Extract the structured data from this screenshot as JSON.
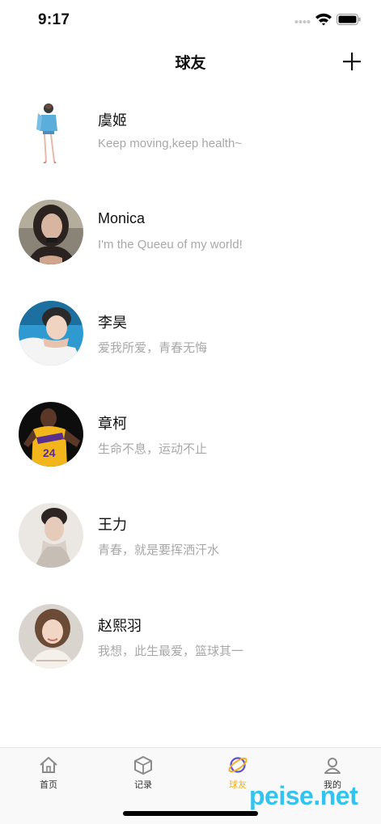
{
  "status_bar": {
    "time": "9:17"
  },
  "nav": {
    "title": "球友",
    "add_icon": "plus-icon"
  },
  "friends": [
    {
      "name": "虞姬",
      "motto": "Keep moving,keep health~",
      "avatar": "illustration"
    },
    {
      "name": "Monica",
      "motto": "I'm the Queeu of my world!",
      "avatar": "photo"
    },
    {
      "name": "李昊",
      "motto": "爱我所爱，青春无悔",
      "avatar": "photo"
    },
    {
      "name": "章柯",
      "motto": "生命不息，运动不止",
      "avatar": "photo"
    },
    {
      "name": "王力",
      "motto": "青春，就是要挥洒汗水",
      "avatar": "photo"
    },
    {
      "name": "赵熙羽",
      "motto": "我想，此生最爱，篮球其一",
      "avatar": "photo"
    }
  ],
  "tabs": [
    {
      "label": "首页",
      "icon": "home-icon",
      "active": false
    },
    {
      "label": "记录",
      "icon": "box-icon",
      "active": false
    },
    {
      "label": "球友",
      "icon": "planet-icon",
      "active": true
    },
    {
      "label": "我的",
      "icon": "user-icon",
      "active": false
    }
  ],
  "watermark": "peise.net",
  "colors": {
    "accent": "#f2b01e",
    "planet": "#5b50d6",
    "motto": "#a8a8a8",
    "watermark": "#32c3ee"
  }
}
